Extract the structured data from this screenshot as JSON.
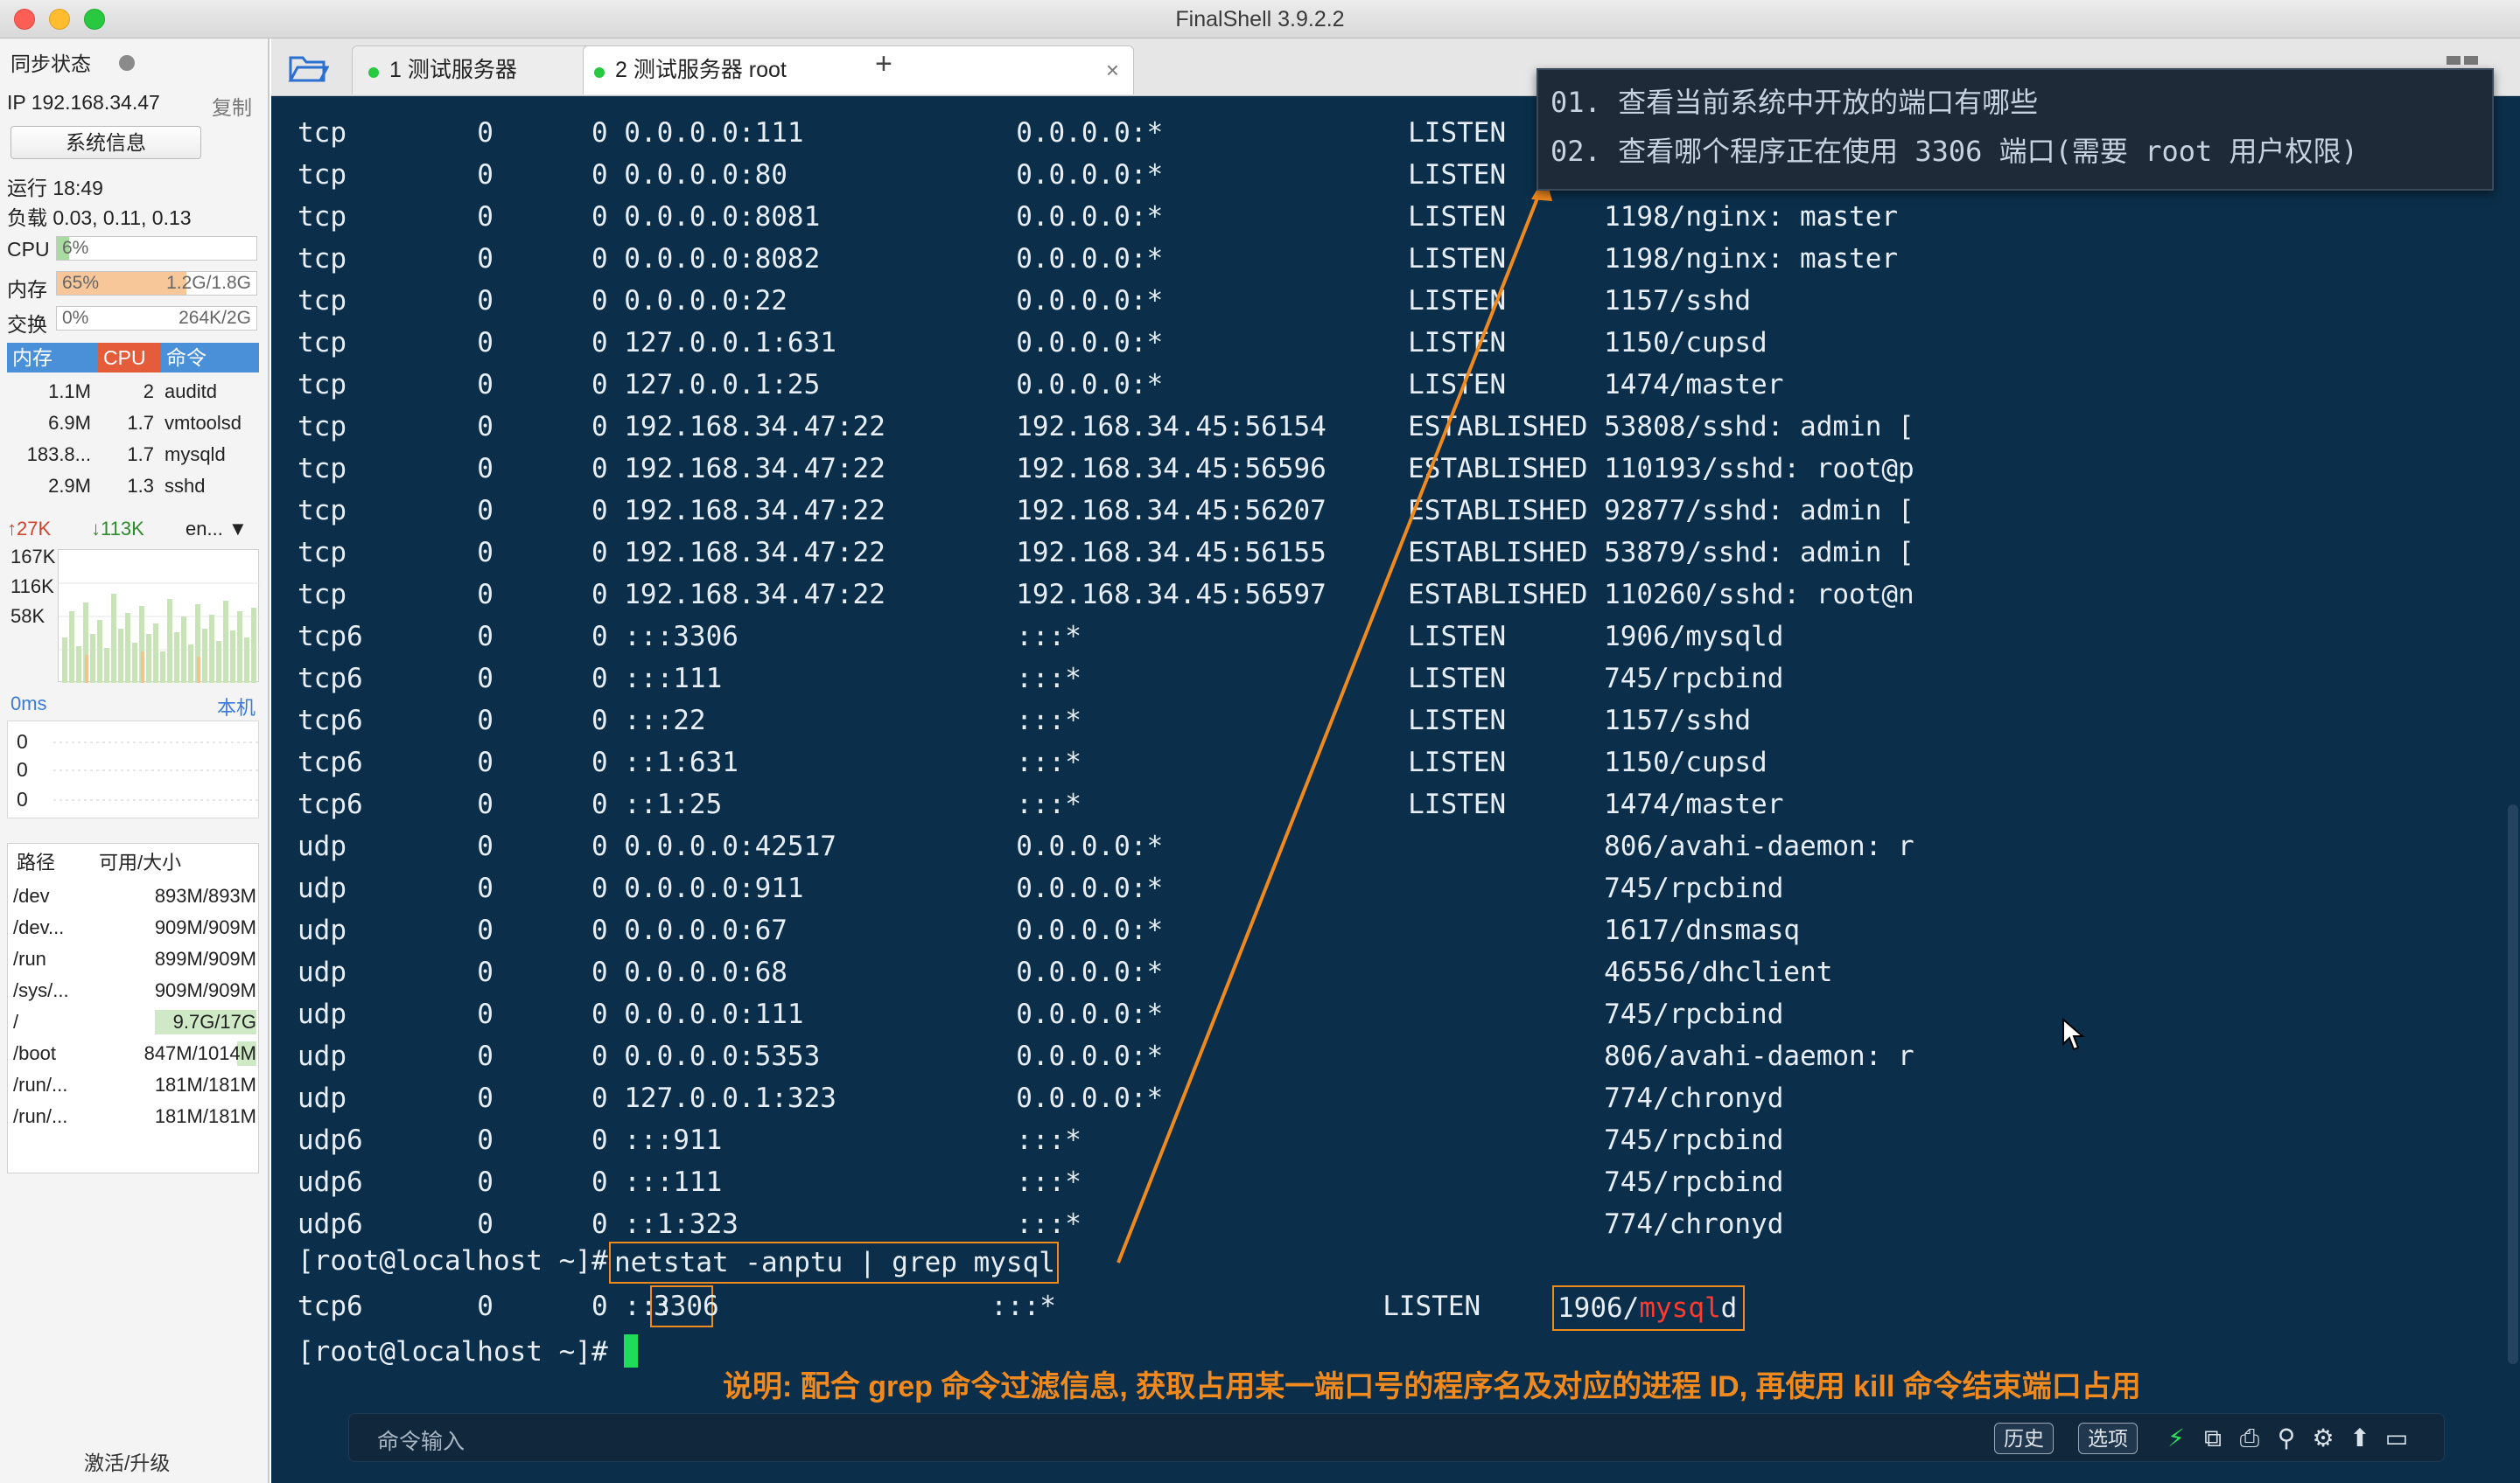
{
  "window": {
    "title": "FinalShell 3.9.2.2"
  },
  "sidebar": {
    "sync_status": "同步状态",
    "ip": "IP 192.168.34.47",
    "copy": "复制",
    "sysinfo": "系统信息",
    "uptime": "运行 18:49",
    "load": "负载 0.03, 0.11, 0.13",
    "cpu_label": "CPU",
    "cpu_value": "6%",
    "cpu_fraction": 0.06,
    "mem_label": "内存",
    "mem_pct": "65%",
    "mem_used": "1.2G/1.8G",
    "mem_fraction": 0.65,
    "swap_label": "交换",
    "swap_pct": "0%",
    "swap_used": "264K/2G",
    "proc_headers": [
      "内存",
      "CPU",
      "命令"
    ],
    "processes": [
      {
        "mem": "1.1M",
        "cpu": "2",
        "cmd": "auditd"
      },
      {
        "mem": "6.9M",
        "cpu": "1.7",
        "cmd": "vmtoolsd"
      },
      {
        "mem": "183.8...",
        "cpu": "1.7",
        "cmd": "mysqld"
      },
      {
        "mem": "2.9M",
        "cpu": "1.3",
        "cmd": "sshd"
      }
    ],
    "net_up": "27K",
    "net_down": "113K",
    "net_iface": "en...",
    "net_scale": [
      "167K",
      "116K",
      "58K"
    ],
    "ping_label": "0ms",
    "ping_host": "本机",
    "ping_values": [
      "0",
      "0",
      "0"
    ],
    "disk_headers": [
      "路径",
      "可用/大小"
    ],
    "disks": [
      {
        "path": "/dev",
        "size": "893M/893M"
      },
      {
        "path": "/dev...",
        "size": "909M/909M"
      },
      {
        "path": "/run",
        "size": "899M/909M"
      },
      {
        "path": "/sys/...",
        "size": "909M/909M"
      },
      {
        "path": "/",
        "size": "9.7G/17G"
      },
      {
        "path": "/boot",
        "size": "847M/1014M"
      },
      {
        "path": "/run/...",
        "size": "181M/181M"
      },
      {
        "path": "/run/...",
        "size": "181M/181M"
      }
    ],
    "activate": "激活/升级"
  },
  "tabs": [
    {
      "label": "1 测试服务器"
    },
    {
      "label": "2 测试服务器 root"
    }
  ],
  "tab_add": "+",
  "tab_close": "×",
  "terminal": {
    "lines": [
      "tcp        0      0 0.0.0.0:111             0.0.0.0:*               LISTEN",
      "tcp        0      0 0.0.0.0:80              0.0.0.0:*               LISTEN",
      "tcp        0      0 0.0.0.0:8081            0.0.0.0:*               LISTEN      1198/nginx: master",
      "tcp        0      0 0.0.0.0:8082            0.0.0.0:*               LISTEN      1198/nginx: master",
      "tcp        0      0 0.0.0.0:22              0.0.0.0:*               LISTEN      1157/sshd",
      "tcp        0      0 127.0.0.1:631           0.0.0.0:*               LISTEN      1150/cupsd",
      "tcp        0      0 127.0.0.1:25            0.0.0.0:*               LISTEN      1474/master",
      "tcp        0      0 192.168.34.47:22        192.168.34.45:56154     ESTABLISHED 53808/sshd: admin [",
      "tcp        0      0 192.168.34.47:22        192.168.34.45:56596     ESTABLISHED 110193/sshd: root@p",
      "tcp        0      0 192.168.34.47:22        192.168.34.45:56207     ESTABLISHED 92877/sshd: admin [",
      "tcp        0      0 192.168.34.47:22        192.168.34.45:56155     ESTABLISHED 53879/sshd: admin [",
      "tcp        0      0 192.168.34.47:22        192.168.34.45:56597     ESTABLISHED 110260/sshd: root@n",
      "tcp6       0      0 :::3306                 :::*                    LISTEN      1906/mysqld",
      "tcp6       0      0 :::111                  :::*                    LISTEN      745/rpcbind",
      "tcp6       0      0 :::22                   :::*                    LISTEN      1157/sshd",
      "tcp6       0      0 ::1:631                 :::*                    LISTEN      1150/cupsd",
      "tcp6       0      0 ::1:25                  :::*                    LISTEN      1474/master",
      "udp        0      0 0.0.0.0:42517           0.0.0.0:*                           806/avahi-daemon: r",
      "udp        0      0 0.0.0.0:911             0.0.0.0:*                           745/rpcbind",
      "udp        0      0 0.0.0.0:67              0.0.0.0:*                           1617/dnsmasq",
      "udp        0      0 0.0.0.0:68              0.0.0.0:*                           46556/dhclient",
      "udp        0      0 0.0.0.0:111             0.0.0.0:*                           745/rpcbind",
      "udp        0      0 0.0.0.0:5353            0.0.0.0:*                           806/avahi-daemon: r",
      "udp        0      0 127.0.0.1:323           0.0.0.0:*                           774/chronyd",
      "udp6       0      0 :::911                  :::*                                745/rpcbind",
      "udp6       0      0 :::111                  :::*                                745/rpcbind",
      "udp6       0      0 ::1:323                 :::*                                774/chronyd"
    ],
    "prompt": "[root@localhost ~]# ",
    "command": "netstat -anptu | grep mysql",
    "result_prefix": "tcp6       0      0 :::",
    "result_port": "3306",
    "result_mid": "                 :::*                    LISTEN      ",
    "result_pid": "1906/",
    "result_match": "mysql",
    "result_end": "d"
  },
  "annotation": {
    "line1": "01. 查看当前系统中开放的端口有哪些",
    "line2": "02. 查看哪个程序正在使用 3306 端口(需要 root 用户权限)"
  },
  "note": "说明: 配合 grep 命令过滤信息, 获取占用某一端口号的程序名及对应的进程 ID, 再使用 kill 命令结束端口占用",
  "cmdbar": {
    "placeholder": "命令输入",
    "history": "历史",
    "options": "选项"
  },
  "colors": {
    "terminal_bg": "#0b2f4a",
    "accent_orange": "#f0891e",
    "cursor_green": "#1fdc5b"
  }
}
